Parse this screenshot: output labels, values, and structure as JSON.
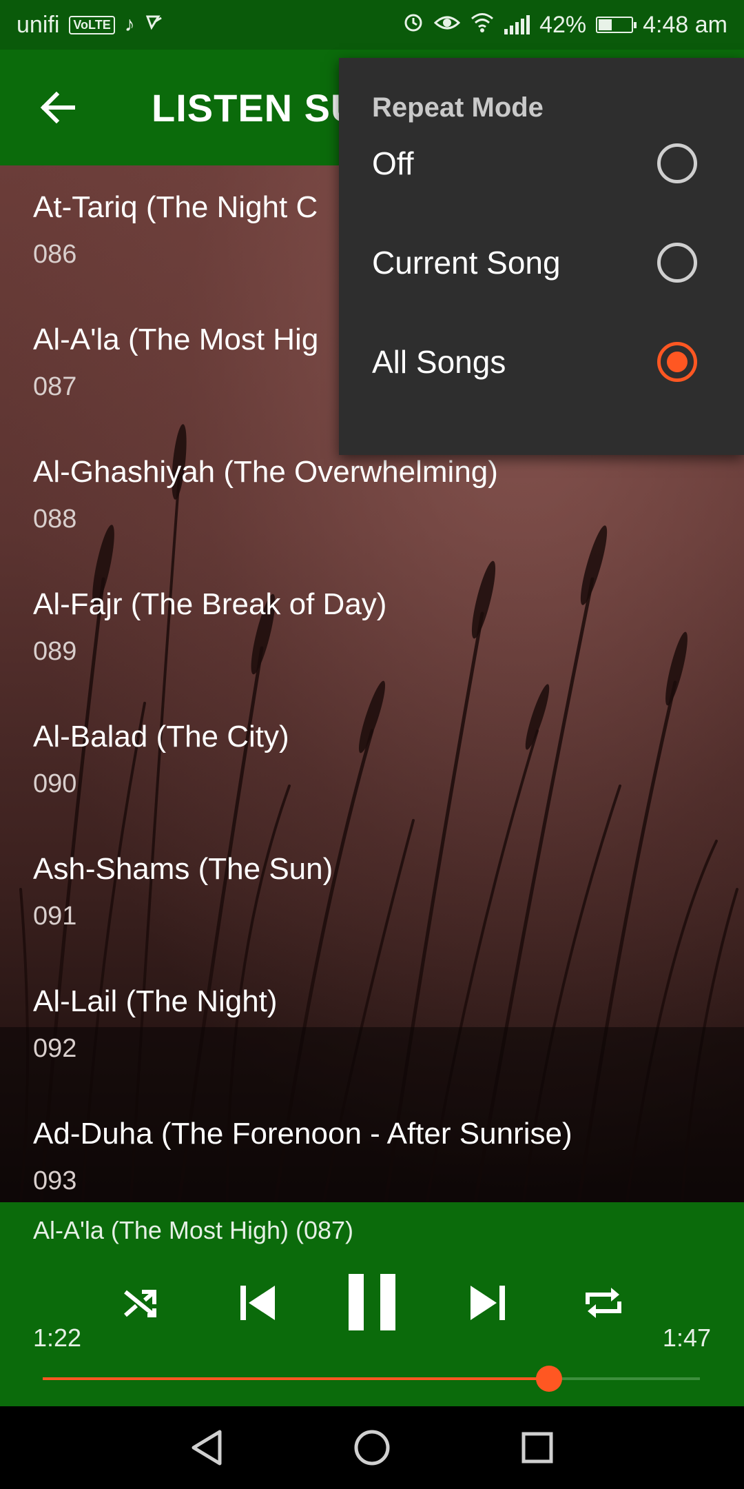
{
  "status_bar": {
    "carrier": "unifi",
    "volte": "VoLTE",
    "battery": "42%",
    "battery_level": 0.42,
    "time": "4:48 am",
    "icons": [
      "music-note-icon",
      "notification-icon",
      "alarm-icon",
      "eye-icon",
      "wifi-icon",
      "signal-icon",
      "battery-charging-icon"
    ]
  },
  "app_bar": {
    "title": "LISTEN SU",
    "back_icon": "arrow-left-icon"
  },
  "list": {
    "items": [
      {
        "title": "At-Tariq (The Night C",
        "number": "086"
      },
      {
        "title": "Al-A'la (The Most Hig",
        "number": "087"
      },
      {
        "title": "Al-Ghashiyah (The Overwhelming)",
        "number": "088"
      },
      {
        "title": "Al-Fajr (The Break of Day)",
        "number": "089"
      },
      {
        "title": "Al-Balad (The City)",
        "number": "090"
      },
      {
        "title": "Ash-Shams (The Sun)",
        "number": "091"
      },
      {
        "title": "Al-Lail (The Night)",
        "number": "092"
      },
      {
        "title": "Ad-Duha (The Forenoon - After Sunrise)",
        "number": "093"
      }
    ]
  },
  "menu": {
    "title": "Repeat Mode",
    "options": [
      {
        "label": "Off",
        "selected": false
      },
      {
        "label": "Current Song",
        "selected": false
      },
      {
        "label": "All Songs",
        "selected": true
      }
    ]
  },
  "player": {
    "now_playing": "Al-A'la (The Most High) (087)",
    "elapsed": "1:22",
    "duration": "1:47",
    "progress": 0.77,
    "controls": [
      "shuffle-icon",
      "previous-icon",
      "pause-icon",
      "next-icon",
      "repeat-icon"
    ]
  },
  "colors": {
    "primary_green": "#0b6b0b",
    "status_green": "#0a5a0a",
    "accent": "#ff5722",
    "menu_bg": "#2e2e2e"
  }
}
